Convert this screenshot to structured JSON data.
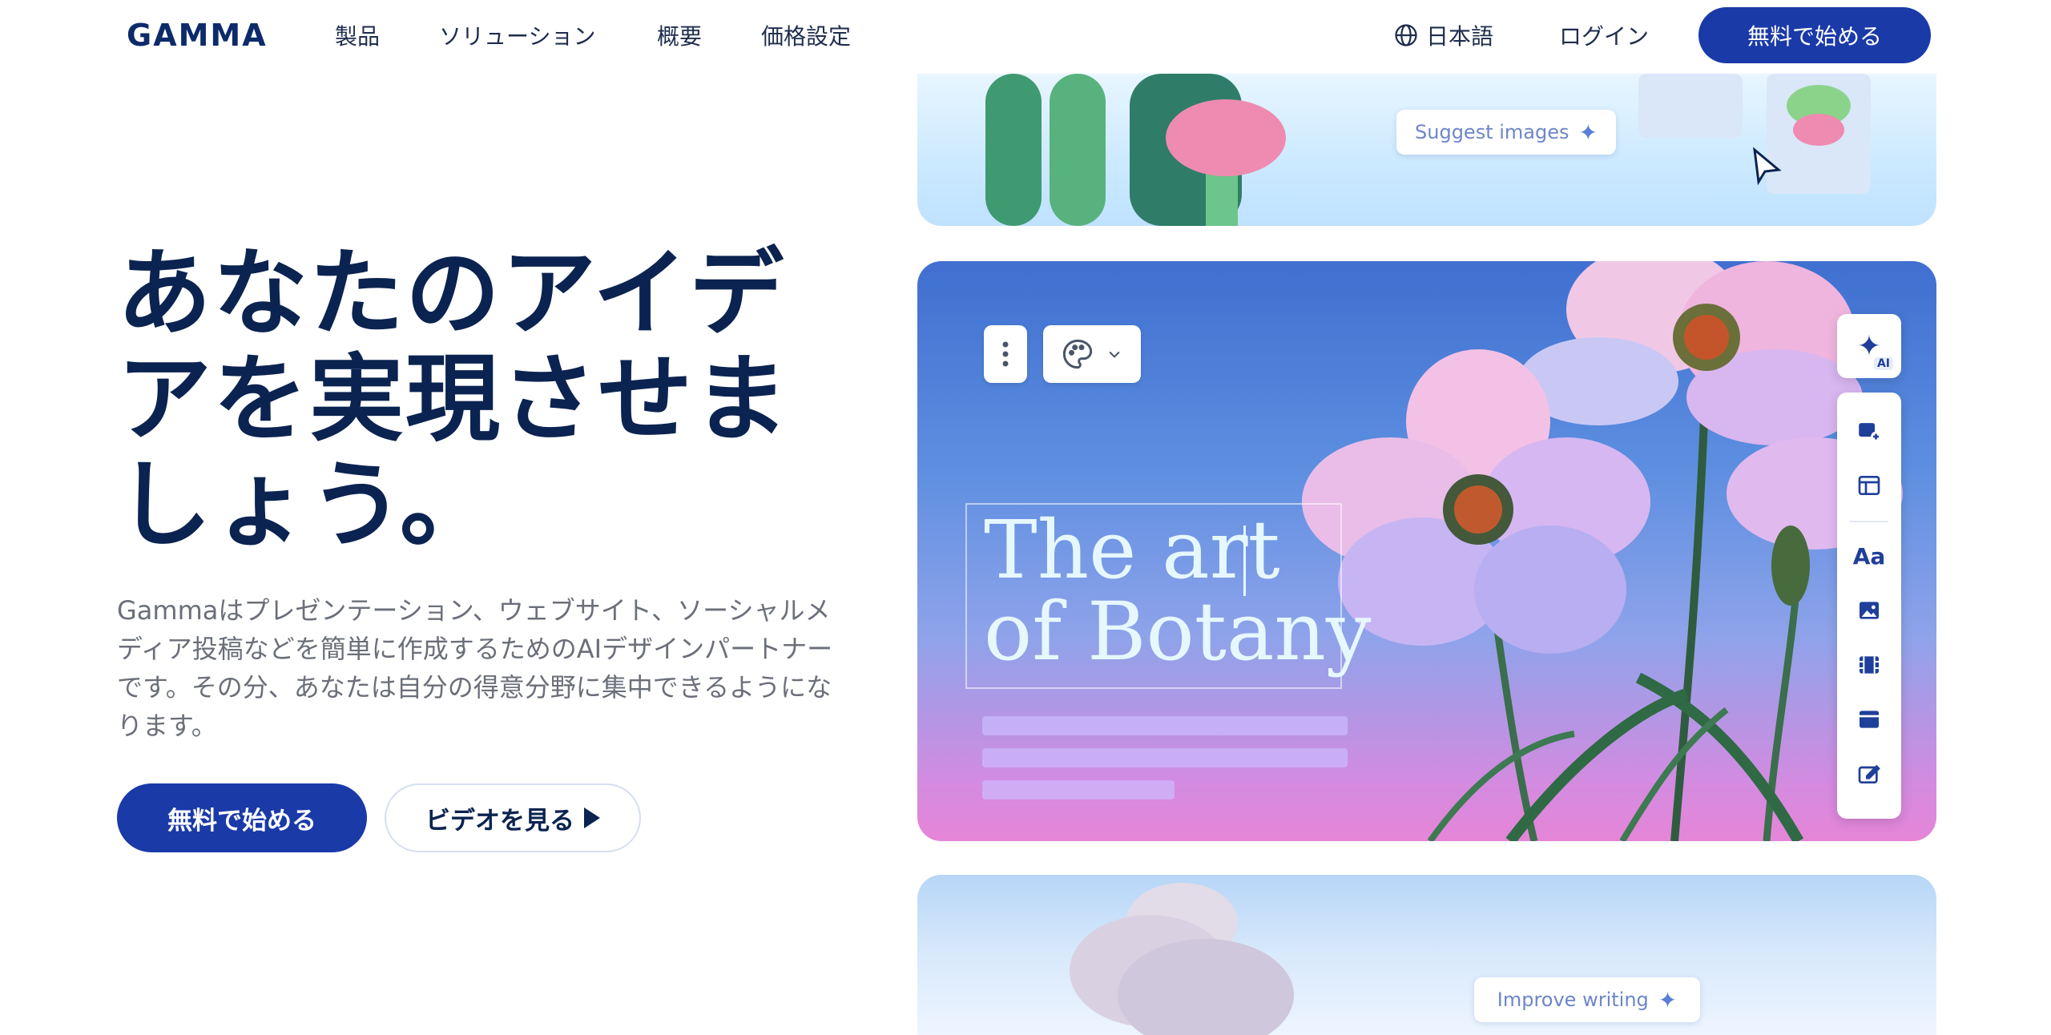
{
  "nav": {
    "logo": "GAMMA",
    "links": [
      "製品",
      "ソリューション",
      "概要",
      "価格設定"
    ],
    "language": "日本語",
    "login": "ログイン",
    "cta": "無料で始める"
  },
  "hero": {
    "title": "あなたのアイデアを実現させましょう。",
    "description": "Gammaはプレゼンテーション、ウェブサイト、ソーシャルメディア投稿などを簡単に作成するためのAIデザインパートナーです。その分、あなたは自分の得意分野に集中できるようになります。",
    "primary_button": "無料で始める",
    "secondary_button": "ビデオを見る"
  },
  "showcase": {
    "suggest_images": "Suggest images",
    "card_title_line1": "The art",
    "card_title_line2": "of Botany",
    "ai_badge": "AI",
    "improve_writing": "Improve writing"
  },
  "icons": {
    "sparkle": "sparkle-icon",
    "globe": "globe-icon",
    "play": "play-icon",
    "palette": "palette-icon",
    "more": "more-vertical-icon"
  },
  "colors": {
    "brand": "#1a3aa8",
    "heading": "#0b2350",
    "body_text": "#6b6f7a"
  }
}
